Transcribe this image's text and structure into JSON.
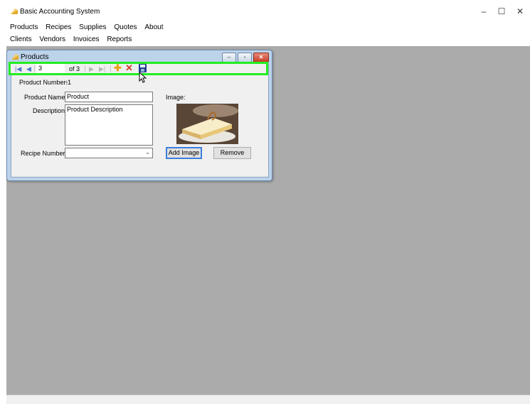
{
  "window": {
    "title": "Basic Accounting System",
    "minimize_glyph": "–",
    "maximize_glyph": "☐",
    "close_glyph": "✕"
  },
  "menus": {
    "row1": [
      "Products",
      "Recipes",
      "Supplies",
      "Quotes",
      "About"
    ],
    "row2": [
      "Clients",
      "Vendors",
      "Invoices",
      "Reports"
    ]
  },
  "child_window": {
    "title": "Products",
    "minimize_glyph": "–",
    "restore_glyph": "▫",
    "close_glyph": "✕"
  },
  "navigator": {
    "position": "3",
    "count_text": "of 3",
    "first_glyph": "|◀",
    "prev_glyph": "◀",
    "next_glyph": "▶",
    "last_glyph": "▶|",
    "add_glyph": "✚",
    "delete_glyph": "✕",
    "highlight_color": "#22ee22"
  },
  "form": {
    "product_number_label": "Product Number:",
    "product_number_value": "-1",
    "product_name_label": "Product Name:",
    "product_name_value": "Product",
    "description_label": "Description:",
    "description_value": "Product Description",
    "image_label": "Image:",
    "recipe_number_label": "Recipe Number:",
    "recipe_number_value": "",
    "add_image_label": "Add Image",
    "remove_label": "Remove"
  },
  "icons": {
    "app": "accounting-app-icon",
    "products": "products-icon",
    "save": "save-icon"
  }
}
